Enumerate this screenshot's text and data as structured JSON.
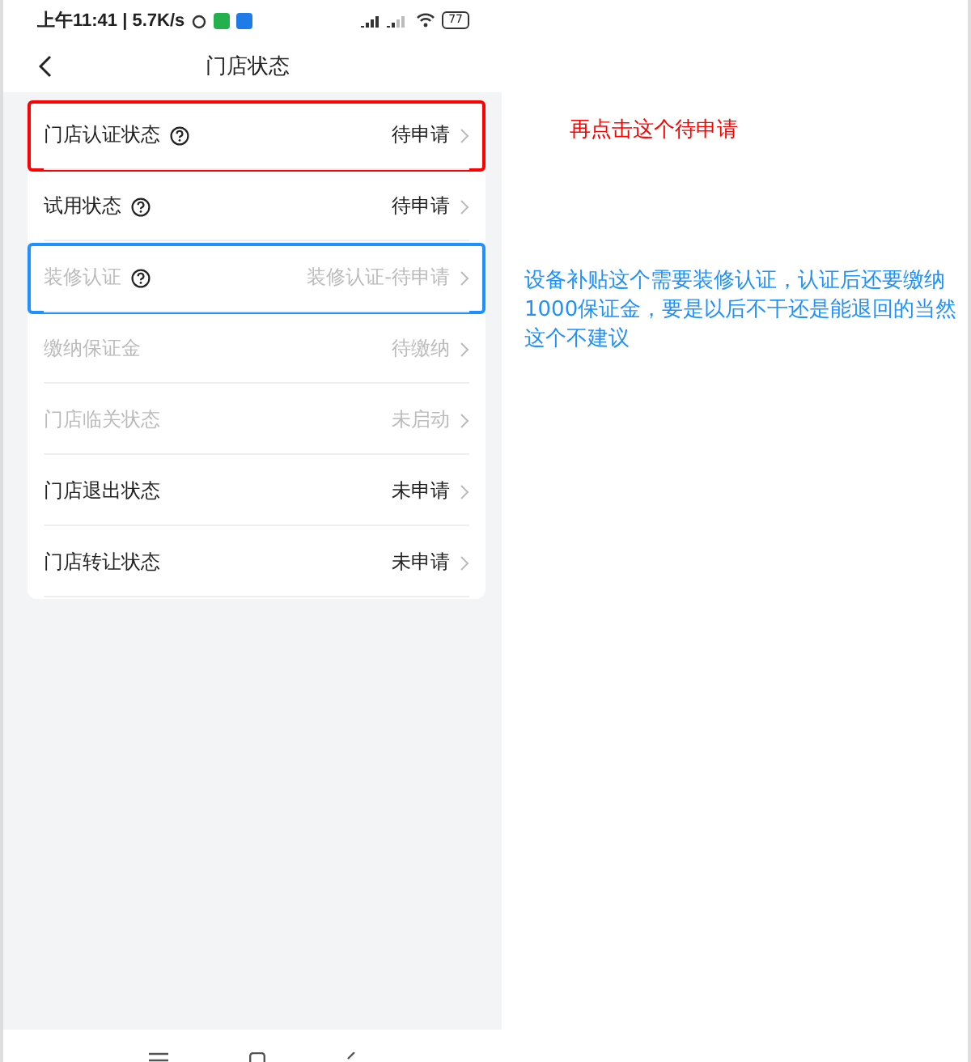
{
  "status_bar": {
    "time": "上午11:41 | 5.7K/s",
    "battery": "77"
  },
  "header": {
    "title": "门店状态"
  },
  "rows": [
    {
      "label": "门店认证状态",
      "help": true,
      "value": "待申请",
      "disabled": false,
      "color": "#ff0000"
    },
    {
      "label": "试用状态",
      "help": true,
      "value": "待申请",
      "disabled": false
    },
    {
      "label": "装修认证",
      "help": true,
      "value": "装修认证-待申请",
      "disabled": true,
      "color": "#1e90ff"
    },
    {
      "label": "缴纳保证金",
      "help": false,
      "value": "待缴纳",
      "disabled": true
    },
    {
      "label": "门店临关状态",
      "help": false,
      "value": "未启动",
      "disabled": true
    },
    {
      "label": "门店退出状态",
      "help": false,
      "value": "未申请",
      "disabled": false
    },
    {
      "label": "门店转让状态",
      "help": false,
      "value": "未申请",
      "disabled": false
    }
  ],
  "annotations": [
    {
      "text": "再点击这个待申请",
      "color": "#ff0000"
    },
    {
      "text": "设备补贴这个需要装修认证，认证后还要缴纳1000保证金，要是以后不干还是能退回的当然这个不建议",
      "color": "#1e90ff"
    }
  ]
}
